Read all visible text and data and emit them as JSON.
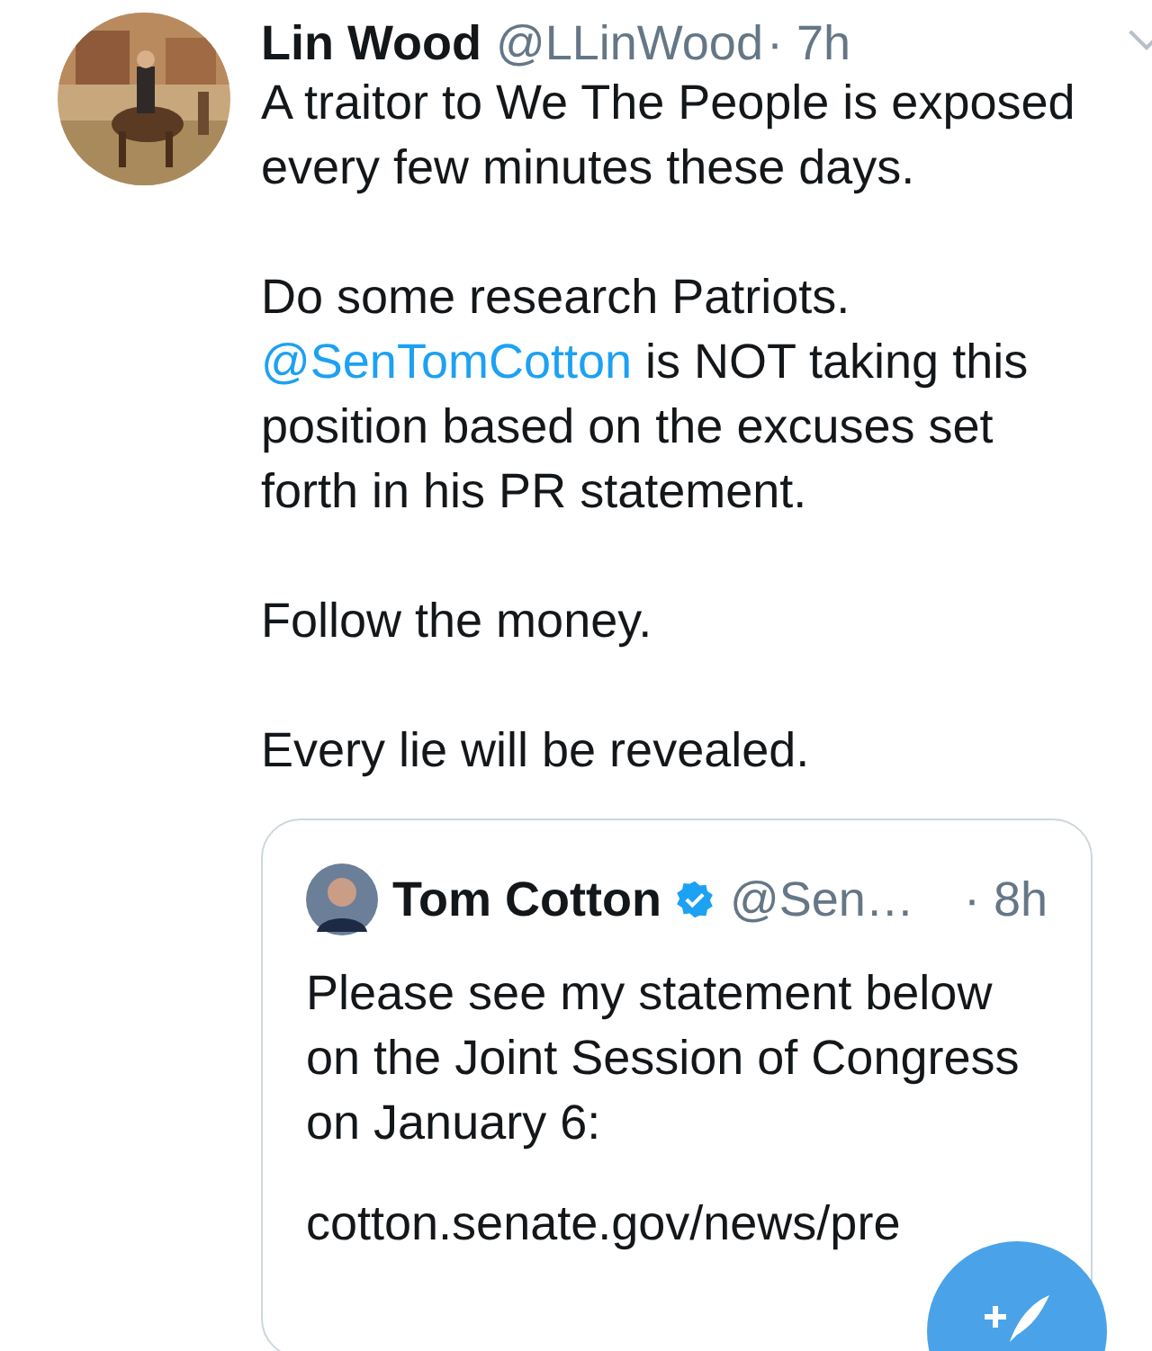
{
  "tweet": {
    "name": "Lin Wood",
    "handle": "@LLinWood",
    "time": "· 7h",
    "paragraphs": [
      [
        {
          "kind": "text",
          "text": "A traitor to We The People is exposed every few minutes these days."
        }
      ],
      [
        {
          "kind": "text",
          "text": "Do some research Patriots. "
        },
        {
          "kind": "mention",
          "text": "@SenTomCotton"
        },
        {
          "kind": "text",
          "text": " is NOT taking this position based on the excuses set forth in his PR statement."
        }
      ],
      [
        {
          "kind": "text",
          "text": "Follow the money."
        }
      ],
      [
        {
          "kind": "text",
          "text": "Every lie will be revealed."
        }
      ]
    ],
    "quote": {
      "name": "Tom Cotton",
      "verified": true,
      "handle": "@Sen…",
      "time": "· 8h",
      "paragraphs": [
        "Please see my statement below on the Joint Session of Congress on January 6:",
        "cotton.senate.gov/news/pre"
      ]
    }
  }
}
